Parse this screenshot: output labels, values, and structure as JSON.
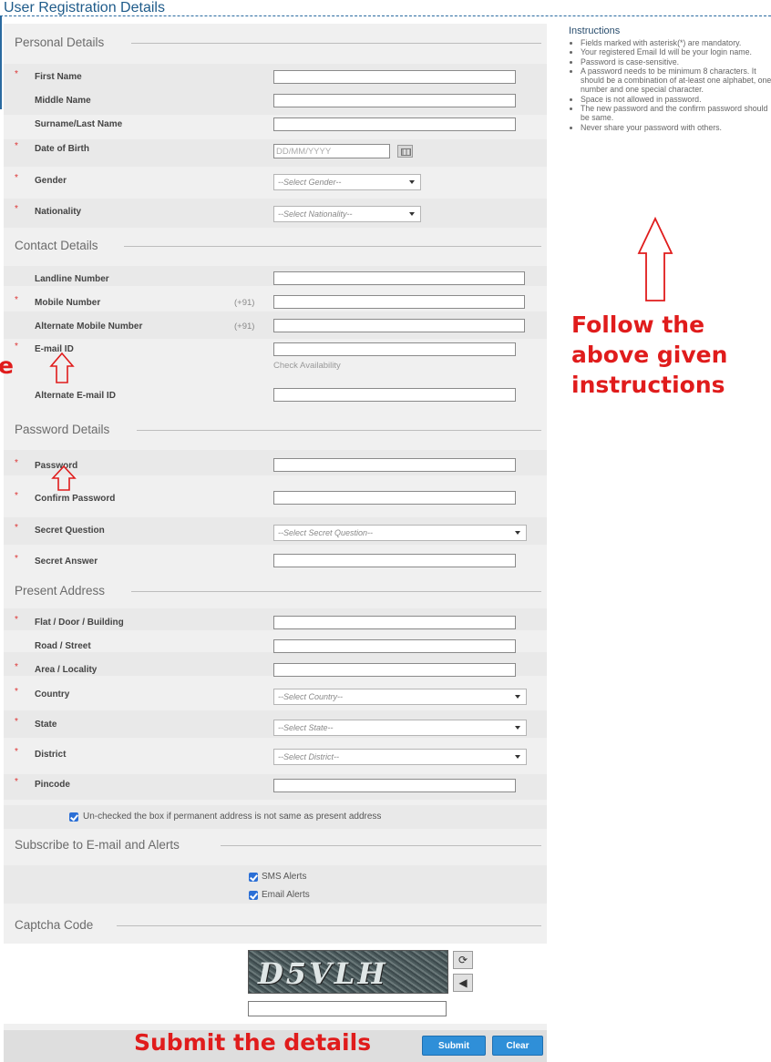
{
  "header": {
    "title": "User Registration Details"
  },
  "sections": {
    "personal": "Personal Details",
    "contact": "Contact Details",
    "password": "Password Details",
    "address": "Present Address",
    "subscribe": "Subscribe to E-mail and Alerts",
    "captcha": "Captcha Code"
  },
  "required_mark": "*",
  "fields": {
    "first_name": "First Name",
    "middle_name": "Middle Name",
    "surname": "Surname/Last Name",
    "dob": "Date of Birth",
    "gender": "Gender",
    "nationality": "Nationality",
    "landline": "Landline Number",
    "mobile": "Mobile Number",
    "alt_mobile": "Alternate Mobile Number",
    "email": "E-mail ID",
    "alt_email": "Alternate E-mail ID",
    "password": "Password",
    "confirm_password": "Confirm Password",
    "secret_question": "Secret Question",
    "secret_answer": "Secret Answer",
    "flat": "Flat / Door / Building",
    "road": "Road / Street",
    "area": "Area / Locality",
    "country": "Country",
    "state": "State",
    "district": "District",
    "pincode": "Pincode"
  },
  "placeholders": {
    "dob": "DD/MM/YYYY",
    "gender": "--Select Gender--",
    "nationality": "--Select Nationality--",
    "secret_question": "--Select Secret Question--",
    "country": "--Select Country--",
    "state": "--Select State--",
    "district": "--Select District--"
  },
  "mobile_prefix": "(+91)",
  "check_availability": "Check Availability",
  "address_checkbox": {
    "label": "Un-checked the box if permanent address is not same as present address",
    "checked": true
  },
  "alerts": [
    {
      "label": "SMS Alerts",
      "checked": true
    },
    {
      "label": "Email Alerts",
      "checked": true
    }
  ],
  "captcha": {
    "text": "D5VLH",
    "refresh_icon": "refresh-icon",
    "audio_icon": "speaker-icon"
  },
  "buttons": {
    "submit": "Submit",
    "clear": "Clear"
  },
  "annotations": {
    "follow_instructions": [
      "Follow the",
      "above given",
      "instructions"
    ],
    "submit_details": "Submit the details",
    "left_fragment": "e",
    "color": "#e01c1c"
  },
  "instructions": {
    "title": "Instructions",
    "items": [
      "Fields marked with asterisk(*) are mandatory.",
      "Your registered Email Id will be your login name.",
      "Password is case-sensitive.",
      "A password needs to be minimum 8 characters. It should be a combination of at-least one alphabet, one number and one special character.",
      "Space is not allowed in password.",
      "The new password and the confirm password should be same.",
      "Never share your password with others."
    ]
  }
}
